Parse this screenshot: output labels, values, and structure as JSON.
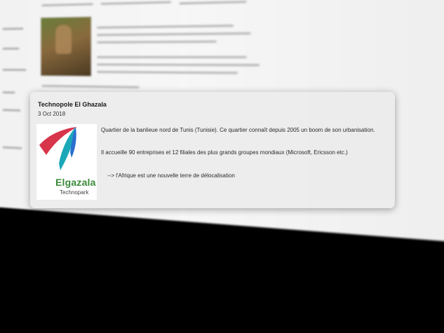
{
  "post": {
    "title": "Technopole El Ghazala",
    "date": "3 Oct 2018",
    "paragraphs": [
      "Quartier de la banlieue nord de Tunis (Tunisie). Ce quartier connaît depuis 2005 un boom de son urbanisation.",
      "Il accueille 90 entreprises et 12 filiales des plus grands groupes mondiaux (Microsoft, Ericsson etc.)",
      "--> l'Afrique est une nouvelle terre de délocalisation"
    ],
    "logo": {
      "wordmark": "Elgazala",
      "tagline": "Technopark",
      "colors": {
        "red": "#d8344a",
        "teal": "#1aa8b8",
        "blue": "#2a6fd0",
        "green": "#3a8a3a"
      }
    }
  },
  "background": {
    "photo_icon": "soldier-photo-icon",
    "thumbnail_icon": "landscape-thumbnail-icon"
  }
}
